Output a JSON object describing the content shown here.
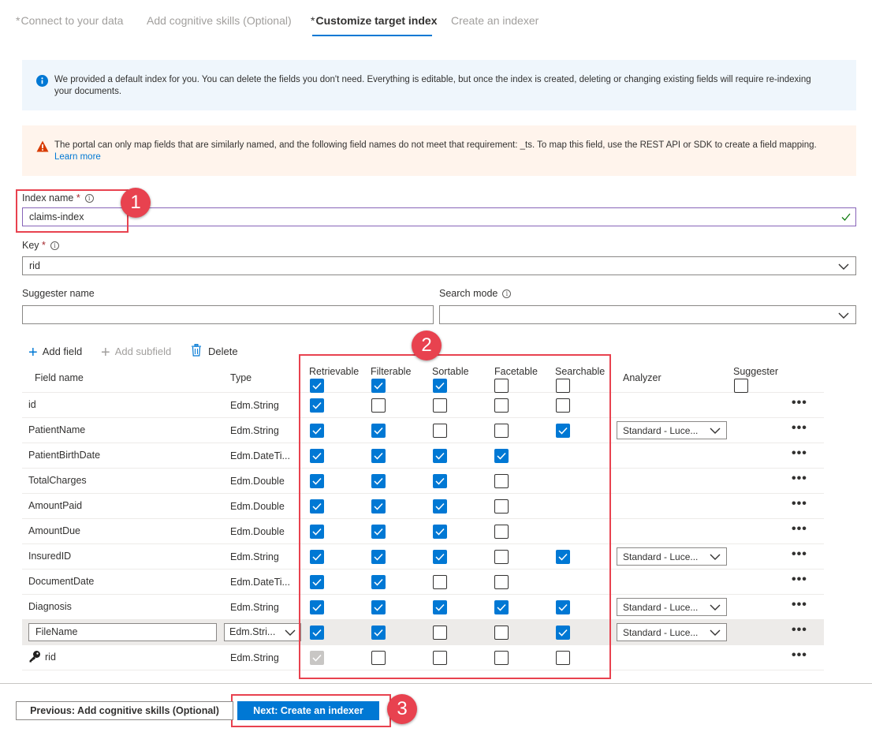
{
  "wizard": {
    "tabs": [
      {
        "label": "Connect to your data",
        "star": "*"
      },
      {
        "label": "Add cognitive skills (Optional)",
        "star": ""
      },
      {
        "label": "Customize target index",
        "star": "*"
      },
      {
        "label": "Create an indexer",
        "star": ""
      }
    ]
  },
  "banners": {
    "info": "We provided a default index for you. You can delete the fields you don't need. Everything is editable, but once the index is created, deleting or changing existing fields will require re-indexing your documents.",
    "warning": "The portal can only map fields that are similarly named, and the following field names do not meet that requirement: _ts. To map this field, use the REST API or SDK to create a field mapping.",
    "warning_link": "Learn more"
  },
  "form": {
    "index_name_label": "Index name",
    "index_name_value": "claims-index",
    "key_label": "Key",
    "key_value": "rid",
    "suggester_label": "Suggester name",
    "suggester_value": "",
    "search_mode_label": "Search mode",
    "search_mode_value": "",
    "required_mark": "*"
  },
  "toolbar": {
    "add_field": "Add field",
    "add_subfield": "Add subfield",
    "delete": "Delete"
  },
  "table": {
    "headers": {
      "field_name": "Field name",
      "type": "Type",
      "retrievable": "Retrievable",
      "filterable": "Filterable",
      "sortable": "Sortable",
      "facetable": "Facetable",
      "searchable": "Searchable",
      "analyzer": "Analyzer",
      "suggester": "Suggester"
    },
    "header_checks": {
      "retrievable": true,
      "filterable": true,
      "sortable": true,
      "facetable": false,
      "searchable": false,
      "suggester": false
    },
    "more_label": "•••",
    "rows": [
      {
        "name": "id",
        "type": "Edm.String",
        "retrievable": true,
        "filterable": false,
        "sortable": false,
        "facetable": false,
        "searchable": false,
        "analyzer": ""
      },
      {
        "name": "PatientName",
        "type": "Edm.String",
        "retrievable": true,
        "filterable": true,
        "sortable": false,
        "facetable": false,
        "searchable": true,
        "analyzer": "Standard - Luce..."
      },
      {
        "name": "PatientBirthDate",
        "type": "Edm.DateTi...",
        "retrievable": true,
        "filterable": true,
        "sortable": true,
        "facetable": true,
        "searchable": null,
        "analyzer": ""
      },
      {
        "name": "TotalCharges",
        "type": "Edm.Double",
        "retrievable": true,
        "filterable": true,
        "sortable": true,
        "facetable": false,
        "searchable": null,
        "analyzer": ""
      },
      {
        "name": "AmountPaid",
        "type": "Edm.Double",
        "retrievable": true,
        "filterable": true,
        "sortable": true,
        "facetable": false,
        "searchable": null,
        "analyzer": ""
      },
      {
        "name": "AmountDue",
        "type": "Edm.Double",
        "retrievable": true,
        "filterable": true,
        "sortable": true,
        "facetable": false,
        "searchable": null,
        "analyzer": ""
      },
      {
        "name": "InsuredID",
        "type": "Edm.String",
        "retrievable": true,
        "filterable": true,
        "sortable": true,
        "facetable": false,
        "searchable": true,
        "analyzer": "Standard - Luce..."
      },
      {
        "name": "DocumentDate",
        "type": "Edm.DateTi...",
        "retrievable": true,
        "filterable": true,
        "sortable": false,
        "facetable": false,
        "searchable": null,
        "analyzer": ""
      },
      {
        "name": "Diagnosis",
        "type": "Edm.String",
        "retrievable": true,
        "filterable": true,
        "sortable": true,
        "facetable": true,
        "searchable": true,
        "analyzer": "Standard - Luce..."
      },
      {
        "name": "FileName",
        "type": "Edm.Stri...",
        "retrievable": true,
        "filterable": true,
        "sortable": false,
        "facetable": false,
        "searchable": true,
        "analyzer": "Standard - Luce...",
        "editing": true
      },
      {
        "name": "rid",
        "type": "Edm.String",
        "retrievable": "disabled",
        "filterable": false,
        "sortable": false,
        "facetable": false,
        "searchable": false,
        "analyzer": "",
        "key": true
      }
    ]
  },
  "annotations": [
    "1",
    "2",
    "3"
  ],
  "footer": {
    "previous_label": "Previous: Add cognitive skills (Optional)",
    "next_label": "Next: Create an indexer"
  },
  "colors": {
    "accent": "#0078d4",
    "annotation": "#e8424f",
    "warning": "#d83b01",
    "success": "#107c10"
  }
}
